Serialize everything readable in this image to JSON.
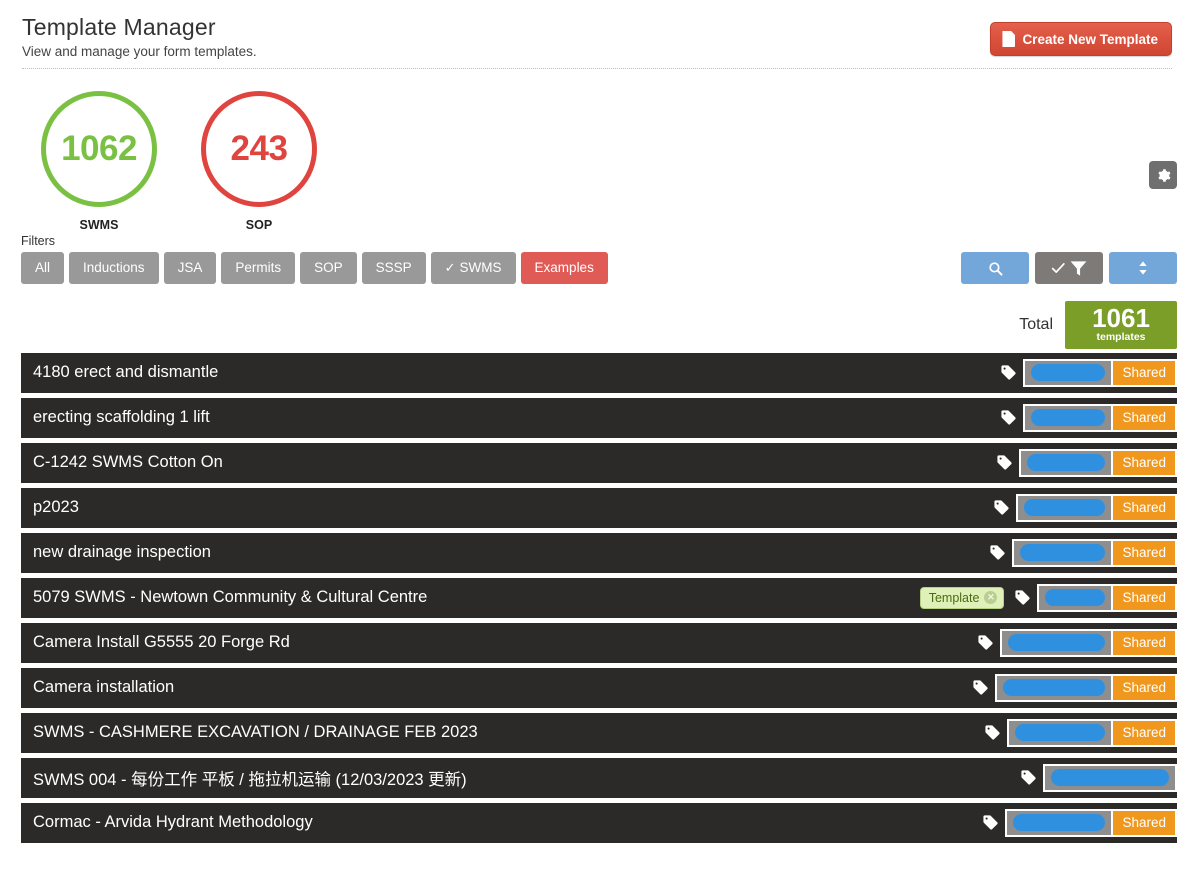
{
  "header": {
    "title": "Template Manager",
    "subtitle": "View and manage your form templates.",
    "create_button": "Create New Template",
    "create_icon": "document-icon",
    "settings_icon": "gear-icon"
  },
  "stats": [
    {
      "value": "1062",
      "label": "SWMS",
      "color": "#7ac143"
    },
    {
      "value": "243",
      "label": "SOP",
      "color": "#e0443f"
    }
  ],
  "filters": {
    "label": "Filters",
    "buttons": [
      {
        "label": "All",
        "active": false,
        "checked": false
      },
      {
        "label": "Inductions",
        "active": false,
        "checked": false
      },
      {
        "label": "JSA",
        "active": false,
        "checked": false
      },
      {
        "label": "Permits",
        "active": false,
        "checked": false
      },
      {
        "label": "SOP",
        "active": false,
        "checked": false
      },
      {
        "label": "SSSP",
        "active": false,
        "checked": false
      },
      {
        "label": "SWMS",
        "active": false,
        "checked": true
      },
      {
        "label": "Examples",
        "active": true,
        "checked": false
      }
    ]
  },
  "actions": [
    {
      "name": "search-button",
      "icon": "search-icon",
      "style": "blue"
    },
    {
      "name": "filter-button",
      "icon": "check-funnel-icon",
      "style": "grey"
    },
    {
      "name": "sort-button",
      "icon": "sort-updown-icon",
      "style": "blue"
    }
  ],
  "total": {
    "label": "Total",
    "count": "1061",
    "unit": "templates"
  },
  "templates": [
    {
      "title": "4180 erect and dismantle",
      "badge": null,
      "tag_icon": "tag-icon",
      "redacted_width": 90,
      "shared_label": "Shared",
      "has_shared": true
    },
    {
      "title": "erecting scaffolding 1 lift",
      "badge": null,
      "tag_icon": "tag-icon",
      "redacted_width": 90,
      "shared_label": "Shared",
      "has_shared": true
    },
    {
      "title": "C-1242 SWMS Cotton On",
      "badge": null,
      "tag_icon": "tag-icon",
      "redacted_width": 94,
      "shared_label": "Shared",
      "has_shared": true
    },
    {
      "title": "p2023",
      "badge": null,
      "tag_icon": "tag-icon",
      "redacted_width": 97,
      "shared_label": "Shared",
      "has_shared": true
    },
    {
      "title": "new drainage inspection",
      "badge": null,
      "tag_icon": "tag-icon",
      "redacted_width": 101,
      "shared_label": "Shared",
      "has_shared": true
    },
    {
      "title": "5079 SWMS - Newtown Community & Cultural Centre",
      "badge": "Template",
      "tag_icon": "tag-icon",
      "redacted_width": 76,
      "shared_label": "Shared",
      "has_shared": true
    },
    {
      "title": "Camera Install G5555 20 Forge Rd",
      "badge": null,
      "tag_icon": "tag-icon",
      "redacted_width": 113,
      "shared_label": "Shared",
      "has_shared": true
    },
    {
      "title": "Camera installation",
      "badge": null,
      "tag_icon": "tag-icon",
      "redacted_width": 118,
      "shared_label": "Shared",
      "has_shared": true
    },
    {
      "title": "SWMS - CASHMERE EXCAVATION / DRAINAGE FEB 2023",
      "badge": null,
      "tag_icon": "tag-icon",
      "redacted_width": 106,
      "shared_label": "Shared",
      "has_shared": true
    },
    {
      "title": "SWMS 004 - 每份工作 平板 / 拖拉机运输 (12/03/2023 更新)",
      "badge": null,
      "tag_icon": "tag-icon",
      "redacted_width": 134,
      "shared_label": "",
      "has_shared": false
    },
    {
      "title": "Cormac - Arvida Hydrant Methodology",
      "badge": null,
      "tag_icon": "tag-icon",
      "redacted_width": 108,
      "shared_label": "Shared",
      "has_shared": true
    }
  ]
}
